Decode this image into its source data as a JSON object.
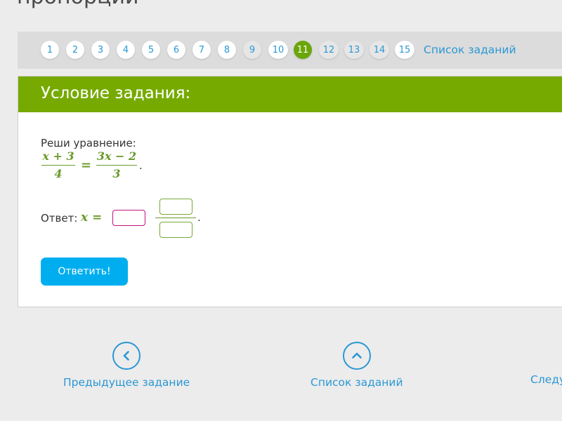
{
  "page_title": "пропорции",
  "pager": {
    "numbers": [
      "1",
      "2",
      "3",
      "4",
      "5",
      "6",
      "7",
      "8",
      "9",
      "10",
      "11",
      "12",
      "13",
      "14",
      "15"
    ],
    "active": "11",
    "task_list_link": "Список заданий"
  },
  "card": {
    "title": "Условие задания:",
    "prompt": "Реши уравнение:",
    "equation": {
      "lhs_num": "x + 3",
      "lhs_den": "4",
      "equals": "=",
      "rhs_num": "3x − 2",
      "rhs_den": "3",
      "end_dot": "."
    },
    "answer_label": "Ответ:",
    "answer_var": "x =",
    "answer_whole_value": "",
    "answer_numerator_value": "",
    "answer_denominator_value": "",
    "answer_end_dot": ".",
    "submit_label": "Ответить!"
  },
  "nav": {
    "prev_label": "Предыдущее задание",
    "list_label": "Список заданий",
    "next_label": "Следу"
  },
  "colors": {
    "accent_green": "#76aa00",
    "active_page": "#6aa60a",
    "link_blue": "#2a98d4",
    "button_blue": "#00aeef",
    "input_border_active": "#c2127e"
  }
}
